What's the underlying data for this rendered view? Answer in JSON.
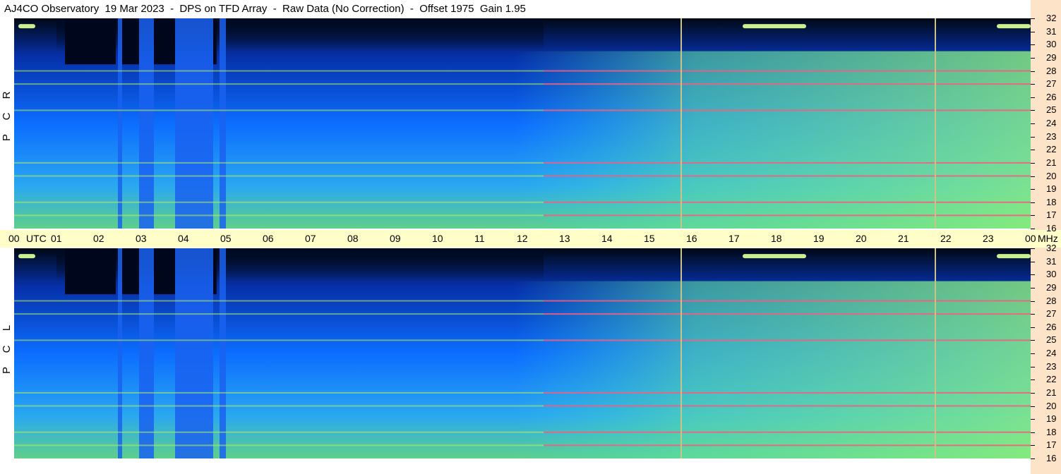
{
  "header": {
    "title": "AJ4CO Observatory  19 Mar 2023  -  DPS on TFD Array  -  Raw Data (No Correction)  -  Offset 1975  Gain 1.95"
  },
  "panels": [
    {
      "id": "rcp",
      "label_letters": [
        "R",
        "C",
        "P"
      ]
    },
    {
      "id": "lcp",
      "label_letters": [
        "L",
        "C",
        "P"
      ]
    }
  ],
  "time_axis": {
    "unit": "UTC",
    "labels": [
      "00",
      "01",
      "02",
      "03",
      "04",
      "05",
      "06",
      "07",
      "08",
      "09",
      "10",
      "11",
      "12",
      "13",
      "14",
      "15",
      "16",
      "17",
      "18",
      "19",
      "20",
      "21",
      "22",
      "23",
      "00"
    ]
  },
  "freq_axis": {
    "unit": "MHz",
    "labels": [
      "32",
      "31",
      "30",
      "29",
      "28",
      "27",
      "26",
      "25",
      "24",
      "23",
      "22",
      "21",
      "20",
      "19",
      "18",
      "17",
      "16"
    ]
  },
  "colors": {
    "low_intensity": "#000d28",
    "mid_intensity": "#0a6cff",
    "high_intensity": "#9bef5c",
    "max_intensity": "#ff3a8c",
    "time_strip": "#fffdc8",
    "freq_strip": "#fde3c8"
  },
  "chart_data": {
    "type": "heatmap",
    "title": "AJ4CO Observatory  19 Mar 2023  -  DPS on TFD Array  -  Raw Data (No Correction)  -  Offset 1975  Gain 1.95",
    "x_axis": {
      "label": "UTC",
      "range": [
        0,
        24
      ],
      "ticks": [
        "00",
        "01",
        "02",
        "03",
        "04",
        "05",
        "06",
        "07",
        "08",
        "09",
        "10",
        "11",
        "12",
        "13",
        "14",
        "15",
        "16",
        "17",
        "18",
        "19",
        "20",
        "21",
        "22",
        "23",
        "00"
      ]
    },
    "y_axis": {
      "label": "MHz",
      "range": [
        16,
        32
      ],
      "ticks": [
        16,
        17,
        18,
        19,
        20,
        21,
        22,
        23,
        24,
        25,
        26,
        27,
        28,
        29,
        30,
        31,
        32
      ]
    },
    "series": [
      {
        "name": "RCP"
      },
      {
        "name": "LCP"
      }
    ],
    "features": {
      "quiet_blocks_utc": [
        [
          1.2,
          2.4
        ],
        [
          2.55,
          2.95
        ],
        [
          3.3,
          3.8
        ],
        [
          4.7,
          4.78
        ]
      ],
      "elevated_blocks_utc": [
        [
          2.45,
          2.55
        ],
        [
          2.95,
          3.3
        ],
        [
          3.8,
          4.7
        ],
        [
          4.85,
          5.0
        ]
      ],
      "vertical_lines_utc": [
        15.75,
        21.75
      ],
      "bright_bands_mhz": [
        17.0,
        18.0,
        20.0,
        21.0,
        25.0,
        27.0,
        28.0
      ],
      "active_period_utc": [
        12.5,
        24.0
      ],
      "hot_segments": [
        {
          "utc": [
            0.1,
            0.5
          ],
          "mhz": 31.4
        },
        {
          "utc": [
            17.2,
            18.7
          ],
          "mhz": 31.4
        },
        {
          "utc": [
            23.2,
            24.0
          ],
          "mhz": 31.4
        }
      ]
    }
  }
}
